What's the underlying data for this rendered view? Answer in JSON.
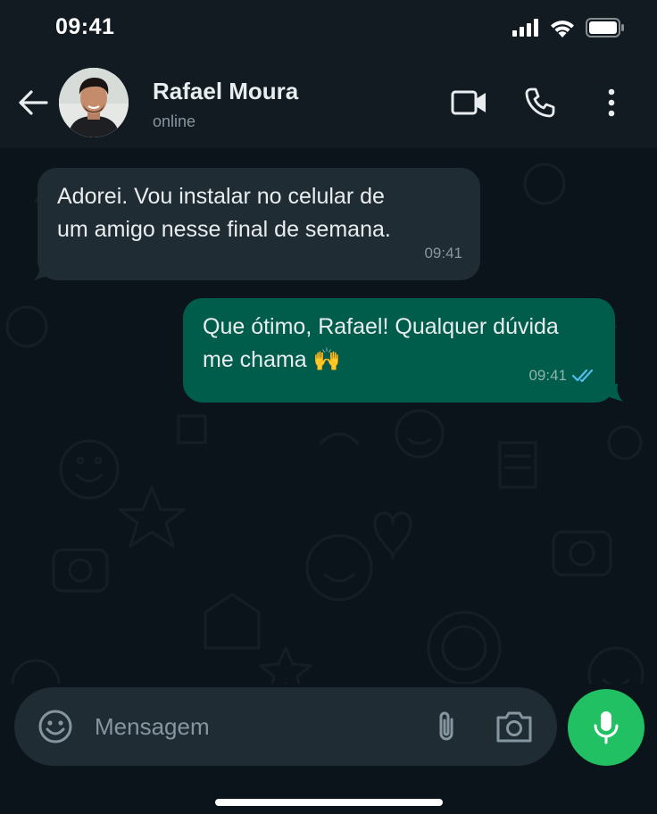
{
  "status_bar": {
    "time": "09:41",
    "icons": [
      "cellular-signal-icon",
      "wifi-icon",
      "battery-icon"
    ]
  },
  "header": {
    "contact_name": "Rafael Moura",
    "contact_status": "online",
    "icons": [
      "back-arrow-icon",
      "video-call-icon",
      "phone-call-icon",
      "more-options-icon"
    ]
  },
  "messages": [
    {
      "direction": "incoming",
      "text": "Adorei. Vou instalar no celular de\num amigo nesse final de semana.",
      "time": "09:41"
    },
    {
      "direction": "outgoing",
      "text": "Que ótimo, Rafael! Qualquer dúvida\nme chama 🙌",
      "time": "09:41",
      "read_receipt": "double-check-read"
    }
  ],
  "composer": {
    "placeholder": "Mensagem",
    "value": "",
    "icons": [
      "emoji-icon",
      "attach-icon",
      "camera-icon",
      "microphone-icon"
    ]
  },
  "colors": {
    "background": "#0b141a",
    "header": "#111b21",
    "incoming_bubble": "#202c33",
    "outgoing_bubble": "#005c4b",
    "read_tick": "#53bdeb",
    "mic_button": "#21c063"
  }
}
